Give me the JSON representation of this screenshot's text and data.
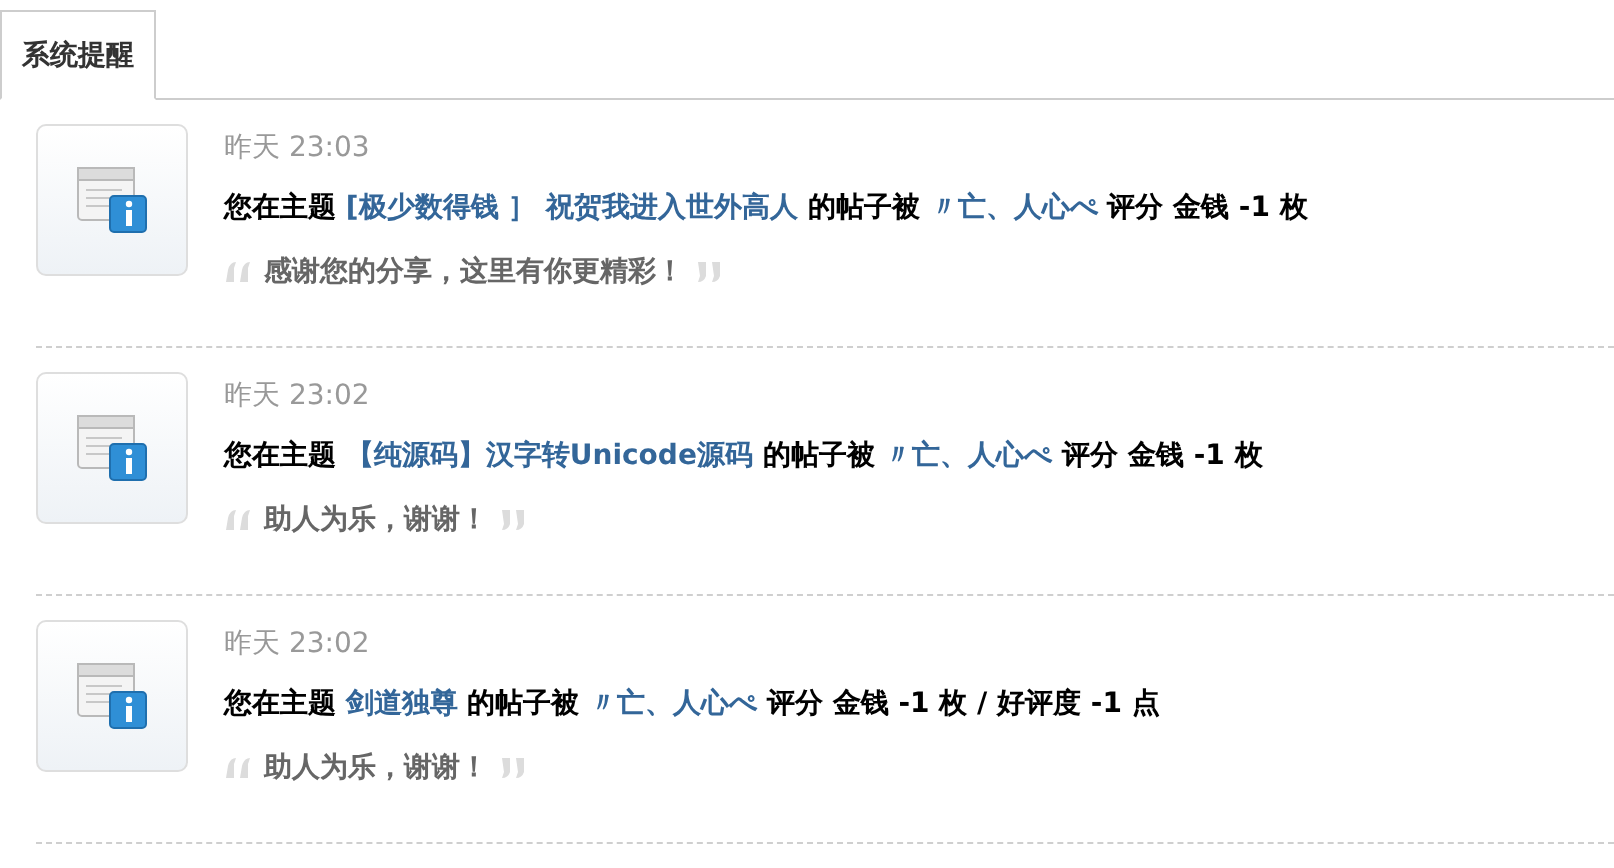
{
  "tabs": [
    {
      "label": "系统提醒",
      "selected": true
    }
  ],
  "notices": [
    {
      "time": "昨天 23:03",
      "prefix": "您在主题",
      "thread": "[极少数得钱 ］ 祝贺我进入世外高人",
      "middle": "的帖子被",
      "user": "〃亡、人心ぺ",
      "suffix": "评分 金钱 -1 枚",
      "quote": "感谢您的分享，这里有你更精彩！"
    },
    {
      "time": "昨天 23:02",
      "prefix": "您在主题",
      "thread": "【纯源码】汉字转Unicode源码",
      "middle": "的帖子被",
      "user": "〃亡、人心ぺ",
      "suffix": "评分 金钱 -1 枚",
      "quote": "助人为乐，谢谢！"
    },
    {
      "time": "昨天 23:02",
      "prefix": "您在主题",
      "thread": "剑道独尊",
      "middle": "的帖子被",
      "user": "〃亡、人心ぺ",
      "suffix": "评分 金钱 -1 枚 / 好评度 -1 点",
      "quote": "助人为乐，谢谢！"
    }
  ]
}
